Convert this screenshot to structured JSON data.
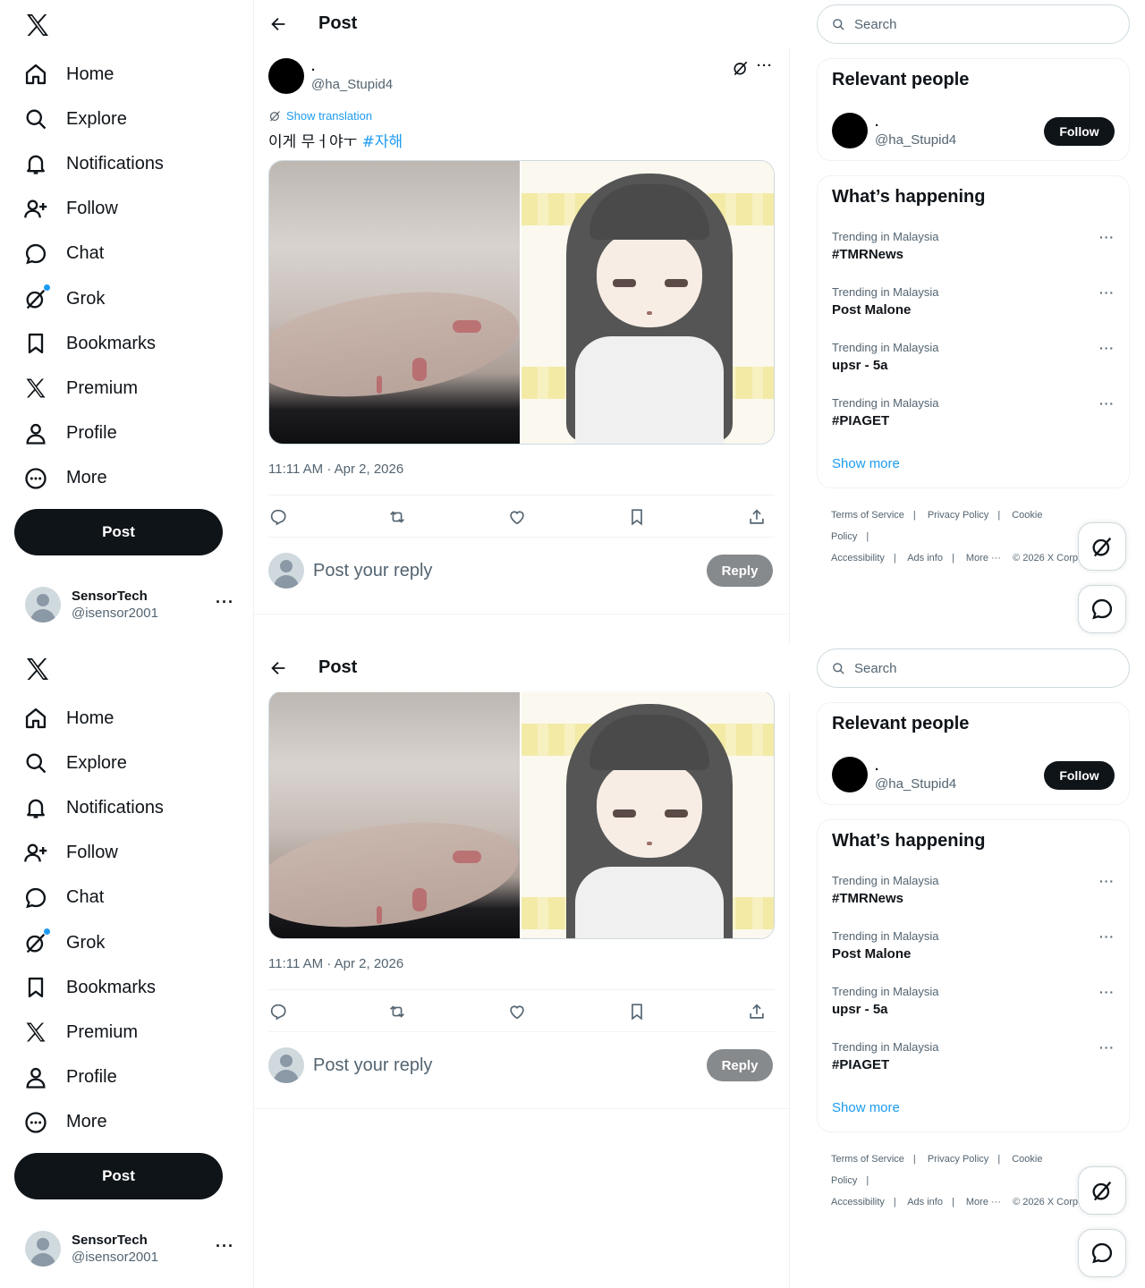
{
  "nav": {
    "items": [
      {
        "label": "Home",
        "icon": "home-icon"
      },
      {
        "label": "Explore",
        "icon": "search-icon"
      },
      {
        "label": "Notifications",
        "icon": "bell-icon"
      },
      {
        "label": "Follow",
        "icon": "add-person-icon"
      },
      {
        "label": "Chat",
        "icon": "chat-icon"
      },
      {
        "label": "Grok",
        "icon": "grok-icon"
      },
      {
        "label": "Bookmarks",
        "icon": "bookmark-icon"
      },
      {
        "label": "Premium",
        "icon": "x-logo-icon"
      },
      {
        "label": "Profile",
        "icon": "person-icon"
      },
      {
        "label": "More",
        "icon": "more-circle-icon"
      }
    ],
    "post_label": "Post"
  },
  "account": {
    "name": "SensorTech",
    "handle": "@isensor2001"
  },
  "header": {
    "title": "Post"
  },
  "tweet": {
    "author_name": ".",
    "author_handle": "@ha_Stupid4",
    "translate_label": "Show translation",
    "text": "이게 무ㅓ야ㅜ ",
    "hashtag": "#자해",
    "timestamp": "11:11 AM · Apr 2, 2026"
  },
  "reply": {
    "placeholder": "Post your reply",
    "button": "Reply"
  },
  "sidebar": {
    "search_placeholder": "Search",
    "relevant_title": "Relevant people",
    "person": {
      "name": ".",
      "handle": "@ha_Stupid4",
      "follow_label": "Follow"
    },
    "happening_title": "What’s happening",
    "trends": [
      {
        "context": "Trending in Malaysia",
        "name": "#TMRNews"
      },
      {
        "context": "Trending in Malaysia",
        "name": "Post Malone"
      },
      {
        "context": "Trending in Malaysia",
        "name": "upsr - 5a"
      },
      {
        "context": "Trending in Malaysia",
        "name": "#PIAGET"
      }
    ],
    "show_more": "Show more",
    "footer": {
      "terms": "Terms of Service",
      "privacy": "Privacy Policy",
      "cookie": "Cookie Policy",
      "accessibility": "Accessibility",
      "ads": "Ads info",
      "more": "More ···",
      "copyright": "© 2026 X Corp."
    }
  },
  "colors": {
    "accent": "#1d9bf0",
    "text": "#0f1419",
    "muted": "#536471",
    "reply_btn": "#878a8c"
  }
}
